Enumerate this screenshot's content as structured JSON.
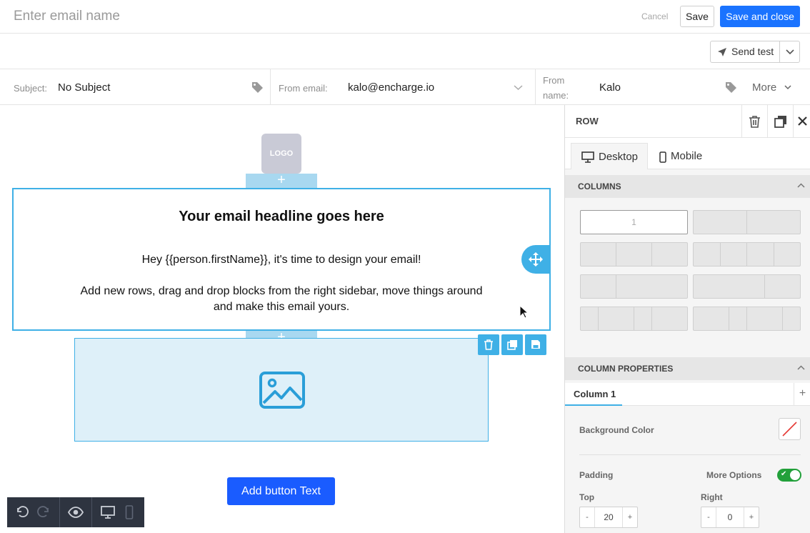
{
  "topbar": {
    "name_placeholder": "Enter email name",
    "cancel": "Cancel",
    "save": "Save",
    "save_close": "Save and close"
  },
  "toolbar2": {
    "send_test": "Send test"
  },
  "meta": {
    "subject_label": "Subject:",
    "subject_value": "No Subject",
    "from_email_label": "From email:",
    "from_email_value": "kalo@encharge.io",
    "from_name_label_1": "From",
    "from_name_label_2": "name:",
    "from_name_value": "Kalo",
    "more": "More"
  },
  "canvas": {
    "logo": "LOGO",
    "headline": "Your email headline goes here",
    "greeting": "Hey {{person.firstName}}, it's time to design your email!",
    "body": "Add new rows, drag and drop blocks from the right sidebar, move things around and make this email yours.",
    "cta": "Add button Text",
    "add_symbol": "+"
  },
  "panel": {
    "title": "ROW",
    "tabs": [
      "Desktop",
      "Mobile"
    ],
    "columns_header": "COLUMNS",
    "single_layout_label": "1",
    "column_props_header": "COLUMN PROPERTIES",
    "column_tab": "Column 1",
    "column_add": "+",
    "bg_color_label": "Background Color",
    "padding_label": "Padding",
    "more_options_label": "More Options",
    "more_options_on": true,
    "top_label": "Top",
    "top_value": "20",
    "right_label": "Right",
    "right_value": "0",
    "minus": "-",
    "plus": "+"
  },
  "colors": {
    "accent": "#3fb0e6",
    "primary_button": "#1a73ff",
    "toggle_on": "#22a03a"
  }
}
